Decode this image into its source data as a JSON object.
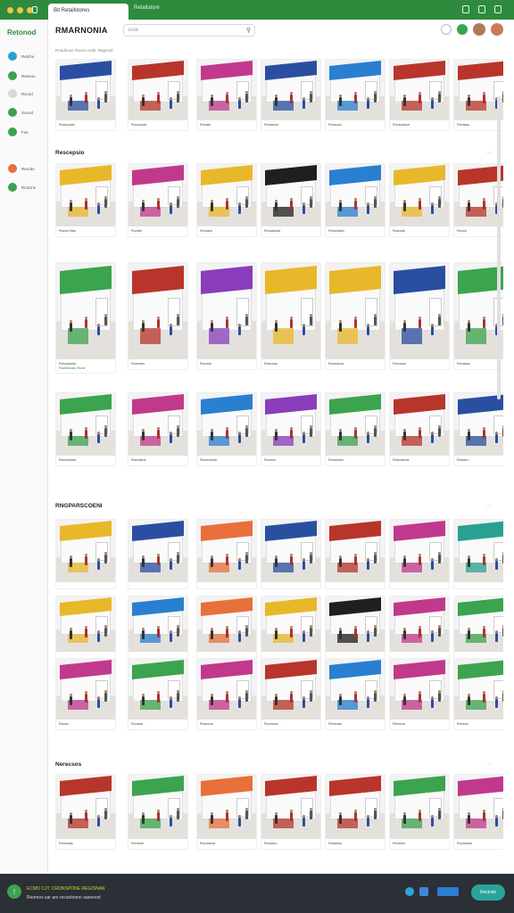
{
  "browser": {
    "tab_title": "Bit Retailstores",
    "tab_secondary": "Retailstore",
    "colors": {
      "chrome": "#2e8b3e"
    }
  },
  "sidebar": {
    "logo_text": "Retonod",
    "items": [
      {
        "label": "Retcho",
        "icon": "home-icon",
        "color": "#2aa1d6"
      },
      {
        "label": "Reesoo",
        "icon": "store-icon",
        "color": "#3ca34e"
      },
      {
        "label": "Rscod",
        "icon": "clock-icon",
        "color": "#d9d9d9"
      },
      {
        "label": "Snood",
        "icon": "leaf-icon",
        "color": "#3ca34e"
      },
      {
        "label": "Fne",
        "icon": "grid-icon",
        "color": "#3ca34e"
      },
      {
        "label": "Rerods",
        "icon": "fire-icon",
        "color": "#e8703a"
      },
      {
        "label": "Rctschs",
        "icon": "globe-icon",
        "color": "#3ca34e"
      }
    ]
  },
  "header": {
    "brand": "RMARNONIA",
    "search_placeholder": "Ends"
  },
  "main": {
    "breadcrumb": "Roadeuse Ronos Arde: Ragendi",
    "sections": [
      {
        "title": "",
        "cards": [
          {
            "caption": "Ronscodio",
            "sub": "",
            "sign": "",
            "color": "#2a4fa0"
          },
          {
            "caption": "Rocuonad",
            "sub": "",
            "sign": "",
            "color": "#b8352b"
          },
          {
            "caption": "Roctan",
            "sub": "",
            "sign": "",
            "color": "#c0398c"
          },
          {
            "caption": "Rectasno",
            "sub": "",
            "sign": "",
            "color": "#2a4fa0"
          },
          {
            "caption": "Rocsous",
            "sub": "",
            "sign": "",
            "color": "#2a7fd0"
          },
          {
            "caption": "Rocsodone",
            "sub": "",
            "sign": "",
            "color": "#b8352b"
          },
          {
            "caption": "Rectaas",
            "sub": "",
            "sign": "",
            "color": "#b8352b"
          }
        ]
      },
      {
        "title": "Rescepsio",
        "cards": [
          {
            "caption": "Roeon Ban",
            "sub": "",
            "sign": "",
            "color": "#e8b82a"
          },
          {
            "caption": "Rcetde",
            "sub": "",
            "sign": "",
            "color": "#c0398c"
          },
          {
            "caption": "Rcmaeu",
            "sub": "",
            "sign": "",
            "color": "#e8b82a"
          },
          {
            "caption": "Recasstod",
            "sub": "",
            "sign": "",
            "color": "#1f1f1f"
          },
          {
            "caption": "Rcesdasin",
            "sub": "",
            "sign": "",
            "color": "#2a7fd0"
          },
          {
            "caption": "Rcsmds",
            "sub": "",
            "sign": "",
            "color": "#e8b82a"
          },
          {
            "caption": "Rexcd",
            "sub": "",
            "sign": "",
            "color": "#b8352b"
          }
        ]
      },
      {
        "title": "",
        "cards": [
          {
            "caption": "Rescadudo",
            "sub": "Roedrecsto Rone",
            "sign": "",
            "color": "#3ca34e"
          },
          {
            "caption": "Rorectes",
            "sub": "",
            "sign": "",
            "color": "#b8352b"
          },
          {
            "caption": "Rorcsio",
            "sub": "",
            "sign": "",
            "color": "#8a3dbb"
          },
          {
            "caption": "Rcsnoas",
            "sub": "",
            "sign": "",
            "color": "#e8b82a"
          },
          {
            "caption": "Rocsdoca",
            "sub": "",
            "sign": "",
            "color": "#e8b82a"
          },
          {
            "caption": "Rocnose",
            "sub": "",
            "sign": "",
            "color": "#2a4fa0"
          },
          {
            "caption": "Recaaso",
            "sub": "",
            "sign": "",
            "color": "#3ca34e"
          }
        ]
      },
      {
        "title": "",
        "cards": [
          {
            "caption": "Rscedodsa",
            "sub": "",
            "sign": "",
            "color": "#3ca34e"
          },
          {
            "caption": "Rasctlens",
            "sub": "",
            "sign": "",
            "color": "#c0398c"
          },
          {
            "caption": "Reonceudo",
            "sub": "",
            "sign": "",
            "color": "#2a7fd0"
          },
          {
            "caption": "Rocsca",
            "sub": "",
            "sign": "",
            "color": "#8a3dbb"
          },
          {
            "caption": "Rcmeosio",
            "sub": "",
            "sign": "",
            "color": "#3ca34e"
          },
          {
            "caption": "Rnecrdeas",
            "sub": "",
            "sign": "",
            "color": "#b8352b"
          },
          {
            "caption": "Rcsaeo",
            "sub": "",
            "sign": "",
            "color": "#2a4fa0"
          }
        ]
      },
      {
        "title": "RNGPARSCOENI",
        "cards": [
          {
            "caption": "",
            "sub": "",
            "sign": "",
            "color": "#e8b82a"
          },
          {
            "caption": "",
            "sub": "",
            "sign": "",
            "color": "#2a4fa0"
          },
          {
            "caption": "",
            "sub": "",
            "sign": "",
            "color": "#e8703a"
          },
          {
            "caption": "",
            "sub": "",
            "sign": "",
            "color": "#2a4fa0"
          },
          {
            "caption": "",
            "sub": "",
            "sign": "",
            "color": "#b8352b"
          },
          {
            "caption": "",
            "sub": "",
            "sign": "",
            "color": "#c0398c"
          },
          {
            "caption": "",
            "sub": "",
            "sign": "",
            "color": "#2aa190"
          }
        ]
      },
      {
        "title": "",
        "cards": [
          {
            "caption": "",
            "sub": "",
            "sign": "",
            "color": "#e8b82a"
          },
          {
            "caption": "",
            "sub": "",
            "sign": "",
            "color": "#2a7fd0"
          },
          {
            "caption": "",
            "sub": "",
            "sign": "",
            "color": "#e8703a"
          },
          {
            "caption": "",
            "sub": "",
            "sign": "",
            "color": "#e8b82a"
          },
          {
            "caption": "",
            "sub": "",
            "sign": "",
            "color": "#1f1f1f"
          },
          {
            "caption": "",
            "sub": "",
            "sign": "",
            "color": "#c0398c"
          },
          {
            "caption": "",
            "sub": "",
            "sign": "",
            "color": "#3ca34e"
          }
        ]
      },
      {
        "title": "",
        "cards": [
          {
            "caption": "Rscas",
            "sub": "",
            "sign": "",
            "color": "#c0398c"
          },
          {
            "caption": "Rcoasd",
            "sub": "",
            "sign": "",
            "color": "#3ca34e"
          },
          {
            "caption": "Rnsceon",
            "sub": "",
            "sign": "",
            "color": "#c0398c"
          },
          {
            "caption": "Rocnesrc",
            "sub": "",
            "sign": "",
            "color": "#b8352b"
          },
          {
            "caption": "Recsodo",
            "sub": "",
            "sign": "",
            "color": "#2a7fd0"
          },
          {
            "caption": "Reorecs",
            "sub": "",
            "sign": "",
            "color": "#c0398c"
          },
          {
            "caption": "Rcesns",
            "sub": "",
            "sign": "",
            "color": "#3ca34e"
          }
        ]
      },
      {
        "title": "Nerecsos",
        "cards": [
          {
            "caption": "Rrcssdas",
            "sub": "",
            "sign": "",
            "color": "#b8352b"
          },
          {
            "caption": "Roctnse",
            "sub": "",
            "sign": "",
            "color": "#3ca34e"
          },
          {
            "caption": "Rocnseud",
            "sub": "",
            "sign": "",
            "color": "#e8703a"
          },
          {
            "caption": "Rcnssco",
            "sub": "",
            "sign": "",
            "color": "#b8352b"
          },
          {
            "caption": "Rcsabsa",
            "sub": "",
            "sign": "",
            "color": "#b8352b"
          },
          {
            "caption": "Recstno",
            "sub": "",
            "sign": "",
            "color": "#3ca34e"
          },
          {
            "caption": "Rocnasbe",
            "sub": "",
            "sign": "",
            "color": "#c0398c"
          }
        ]
      }
    ]
  },
  "footer": {
    "line1": "ECMO CJT; CRONSPONE REGISNAN",
    "line2": "Reomes sar anr recsetonno aanenod",
    "button_label": "Recinds"
  }
}
